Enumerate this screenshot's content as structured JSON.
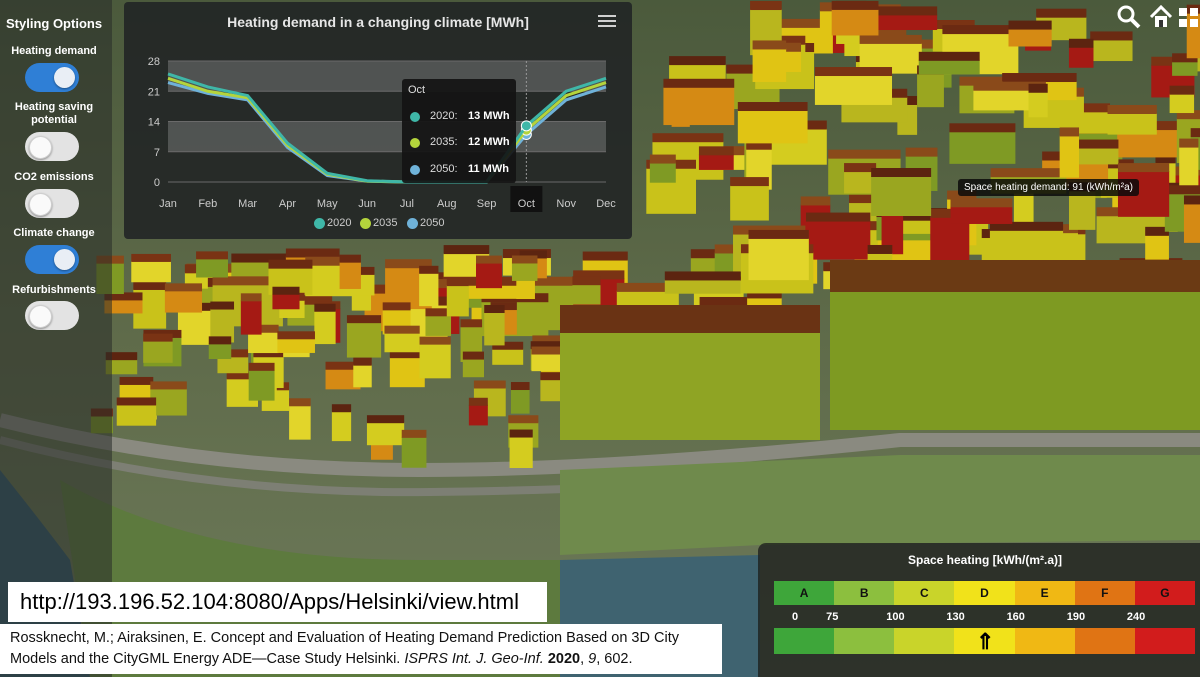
{
  "styling_panel": {
    "title": "Styling Options",
    "options": [
      {
        "label": "Heating demand",
        "on": true
      },
      {
        "label": "Heating saving potential",
        "on": false
      },
      {
        "label": "CO2 emissions",
        "on": false
      },
      {
        "label": "Climate change",
        "on": true
      },
      {
        "label": "Refurbishments",
        "on": false
      }
    ]
  },
  "toolbar": {
    "search_icon": "search-icon",
    "home_icon": "home-icon",
    "grid_icon": "grid-icon"
  },
  "map_tooltip": "Space heating demand: 91 (kWh/m²a)",
  "url": "http://193.196.52.104:8080/Apps/Helsinki/view.html",
  "citation": {
    "text_plain": "Rossknecht, M.; Airaksinen, E. Concept and Evaluation of Heating Demand Prediction Based on 3D City Models and the CityGML Energy ADE—Case Study Helsinki. ",
    "journal": "ISPRS Int. J. Geo-Inf.",
    "year": "2020",
    "volume": "9",
    "pages": ", 602."
  },
  "energy_scale": {
    "title": "Space heating [kWh/(m².a)]",
    "classes": [
      "A",
      "B",
      "C",
      "D",
      "E",
      "F",
      "G"
    ],
    "colors": [
      "#3ea63a",
      "#8cbf3e",
      "#c9d42a",
      "#f1e21a",
      "#f0b814",
      "#e07414",
      "#d21c1c"
    ],
    "thresholds": [
      "0",
      "75",
      "100",
      "130",
      "160",
      "190",
      "240"
    ],
    "marker": "⇑"
  },
  "chart_data": {
    "type": "line",
    "title": "Heating demand in a changing climate [MWh]",
    "xlabel": "",
    "ylabel": "",
    "categories": [
      "Jan",
      "Feb",
      "Mar",
      "Apr",
      "May",
      "Jun",
      "Jul",
      "Aug",
      "Sep",
      "Oct",
      "Nov",
      "Dec"
    ],
    "yticks": [
      0,
      7,
      14,
      21,
      28
    ],
    "ylim": [
      0,
      28
    ],
    "series": [
      {
        "name": "2020",
        "color": "#3fb7a8",
        "values": [
          25,
          22,
          20,
          9,
          2,
          0.3,
          0,
          0,
          0,
          13,
          21,
          24
        ]
      },
      {
        "name": "2035",
        "color": "#b4d43c",
        "values": [
          24,
          21,
          19.5,
          8.5,
          1.8,
          0.2,
          0,
          0,
          0,
          12,
          20,
          23
        ]
      },
      {
        "name": "2050",
        "color": "#6fb2d9",
        "values": [
          23,
          20.5,
          19,
          8,
          1.5,
          0.2,
          0,
          0,
          0,
          11,
          19,
          22
        ]
      }
    ],
    "highlight": "Oct",
    "tooltip": {
      "header": "Oct",
      "rows": [
        {
          "name": "2020:",
          "value": "13 MWh"
        },
        {
          "name": "2035:",
          "value": "12 MWh"
        },
        {
          "name": "2050:",
          "value": "11 MWh"
        }
      ]
    }
  }
}
